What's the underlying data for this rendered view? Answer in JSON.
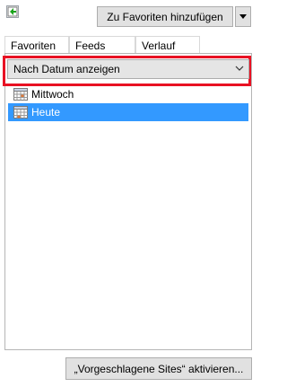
{
  "toolbar": {
    "pin_icon": "pin-green-arrow-icon",
    "add_favorites_label": "Zu Favoriten hinzufügen",
    "dropdown_icon": "triangle-down-icon"
  },
  "tabs": [
    {
      "label": "Favoriten"
    },
    {
      "label": "Feeds"
    },
    {
      "label": "Verlauf"
    }
  ],
  "view_select": {
    "value": "Nach Datum anzeigen",
    "icon": "chevron-down-icon"
  },
  "history": [
    {
      "label": "Mittwoch",
      "icon": "calendar-icon",
      "selected": false
    },
    {
      "label": "Heute",
      "icon": "calendar-icon",
      "selected": true
    }
  ],
  "footer": {
    "suggested_sites_label": "„Vorgeschlagene Sites“ aktivieren..."
  },
  "colors": {
    "selection": "#3399ff",
    "highlight_border": "#e81123",
    "pin_green": "#1aa31a"
  }
}
